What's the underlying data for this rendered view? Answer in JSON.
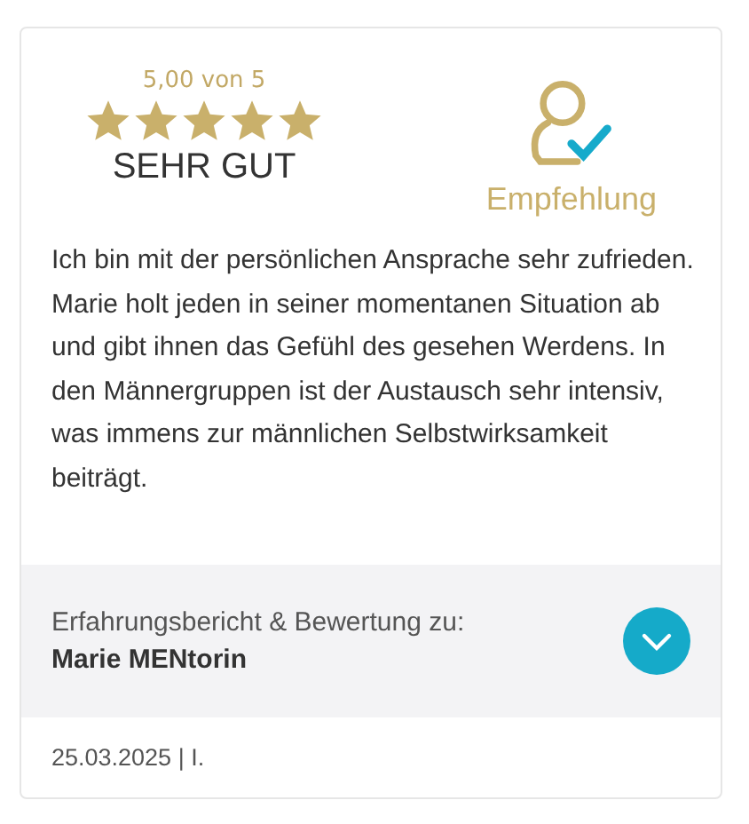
{
  "rating": {
    "score": "5,00 von 5",
    "stars": 5,
    "verdict": "SEHR GUT"
  },
  "recommendation": {
    "label": "Empfehlung",
    "recommended": true
  },
  "review_text": "Ich bin mit der persönlichen Ansprache sehr zufrieden.\nMarie holt jeden in seiner momentanen Situation ab und gibt ihnen das Gefühl des gesehen Werdens. In den Männergruppen ist der Austausch sehr intensiv, was immens zur männlichen Selbstwirksamkeit beiträgt.",
  "subject": {
    "intro": "Erfahrungsbericht & Bewertung zu:",
    "name": "Marie MENtorin",
    "expanded": false
  },
  "footer": "25.03.2025 | I."
}
